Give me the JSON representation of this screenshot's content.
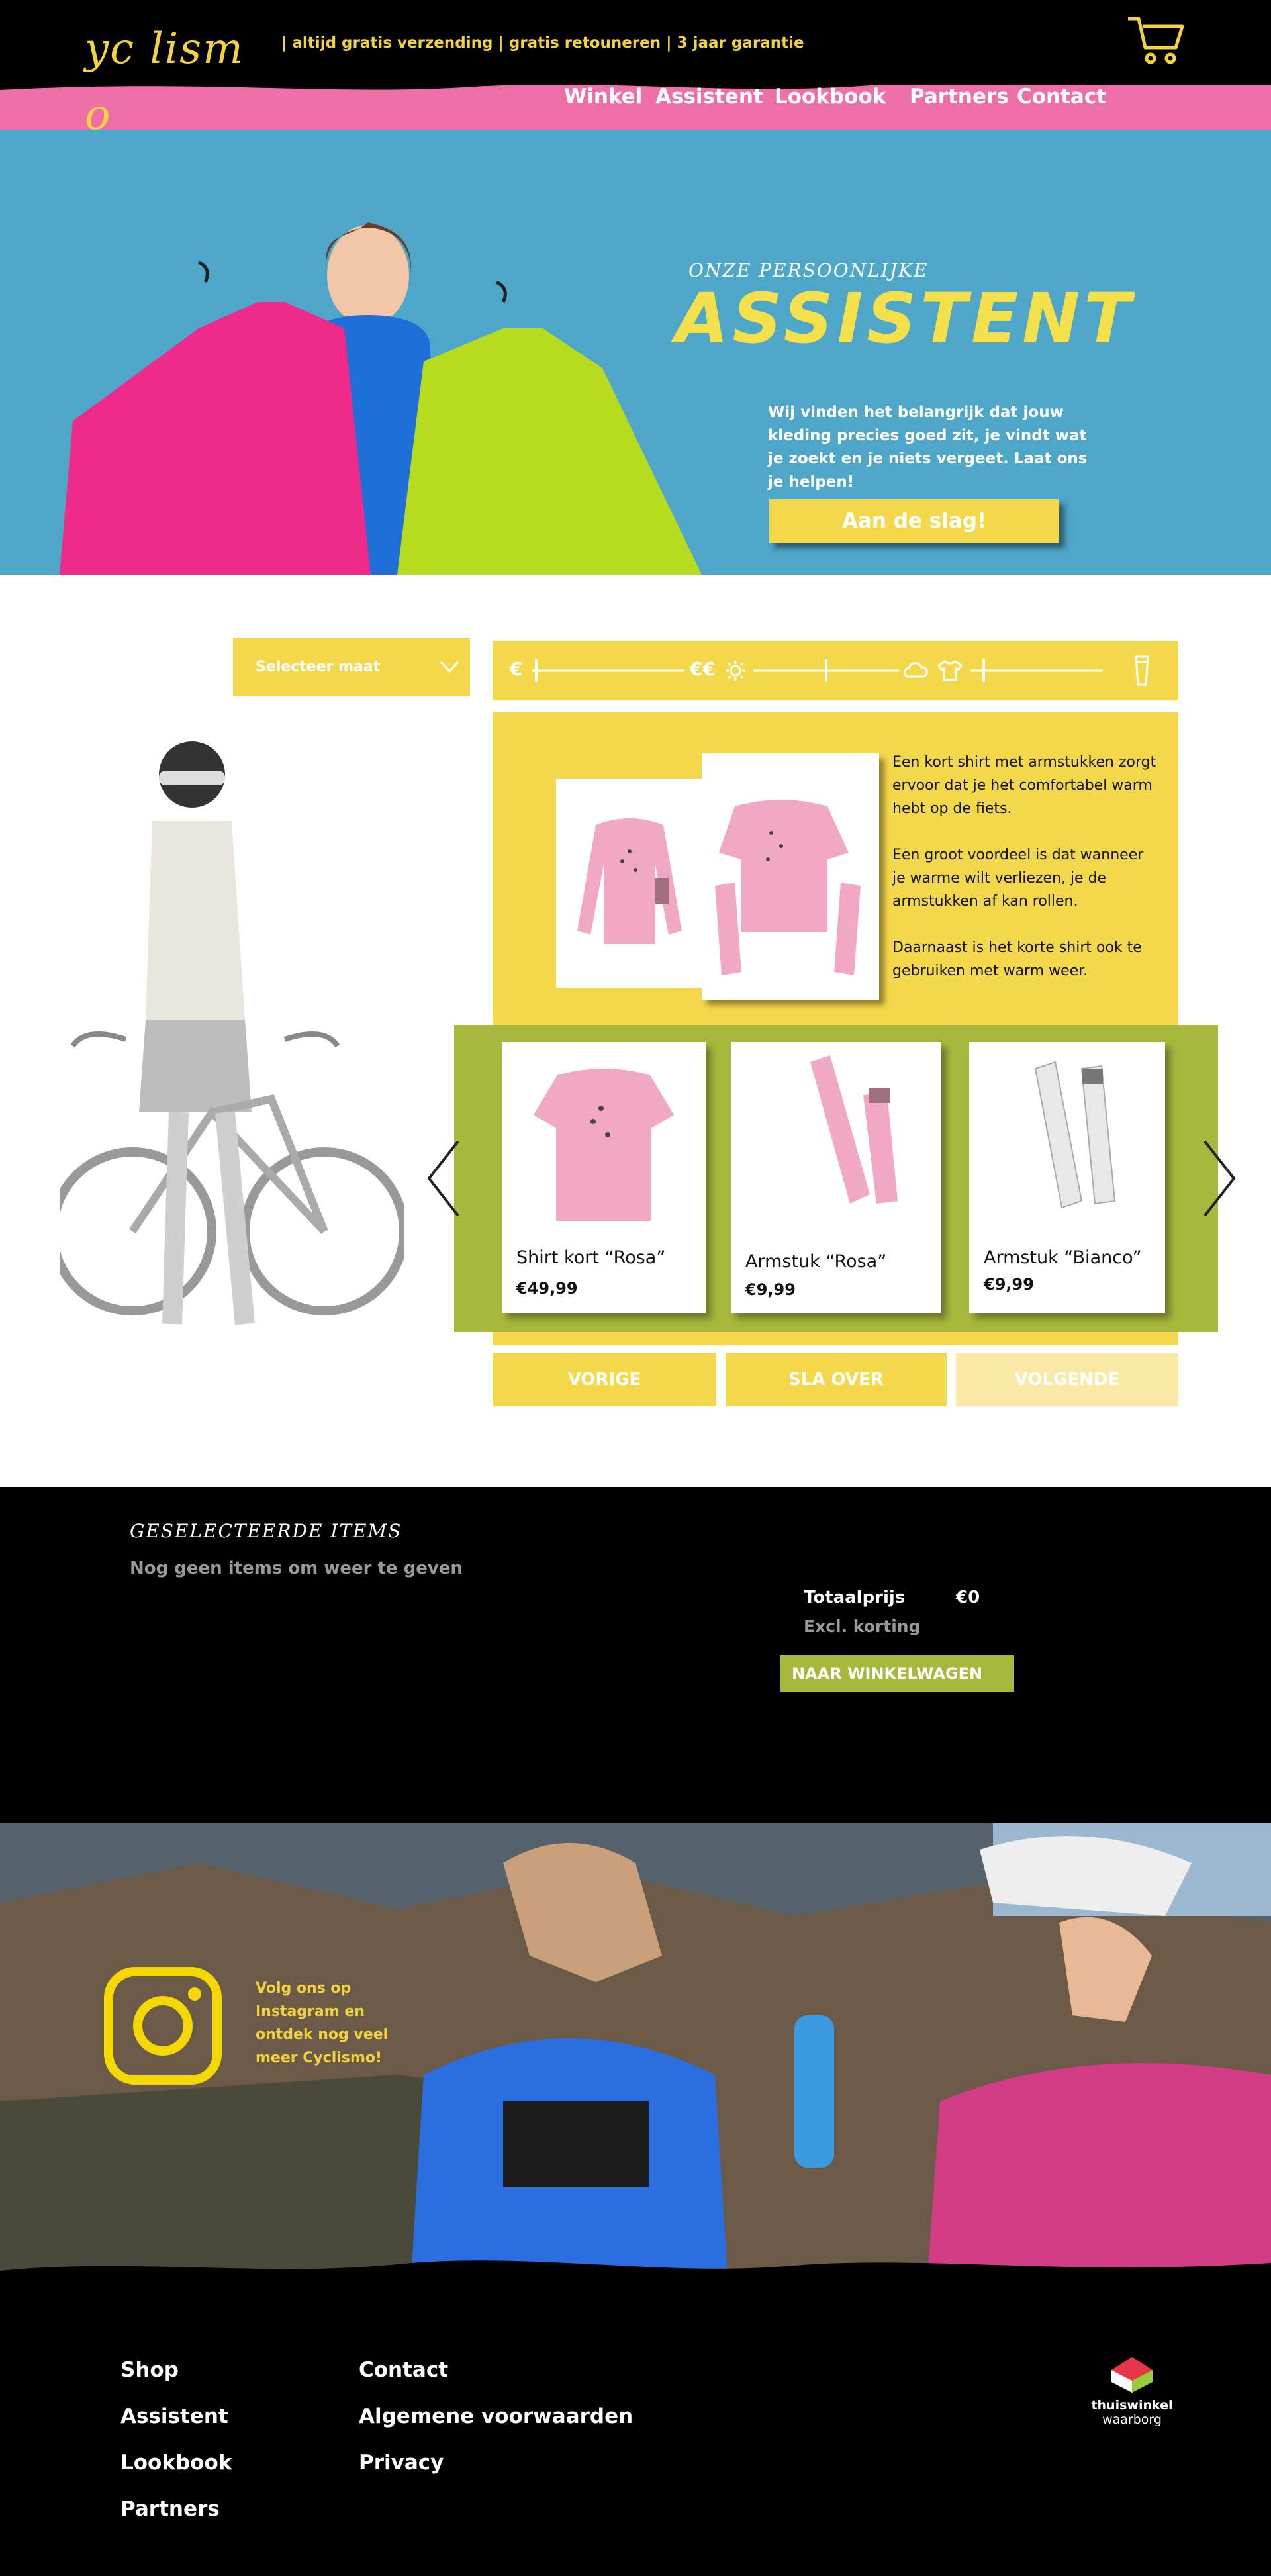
{
  "header": {
    "logo_text": "yc lism o",
    "tagline": "| altijd gratis verzending | gratis retouneren | 3 jaar garantie",
    "nav": [
      "Winkel",
      "Assistent",
      "Lookbook",
      "Partners",
      "Contact"
    ]
  },
  "hero": {
    "subtitle": "ONZE PERSOONLIJKE",
    "title": "ASSISTENT",
    "text": "Wij vinden het belangrijk dat jouw kleding precies goed zit, je vindt wat je zoekt en je niets vergeet. Laat ons je helpen!",
    "cta": "Aan de slag!"
  },
  "assistant": {
    "size_select": "Selecteer maat",
    "filter": {
      "price_low": "€",
      "price_high": "€€"
    },
    "description": [
      "Een kort shirt met armstukken zorgt ervoor dat je het comfortabel warm hebt op de fiets.",
      "Een groot voordeel is dat wanneer je warme wilt verliezen, je de armstukken af kan rollen.",
      "Daarnaast is het korte shirt ook te gebruiken met warm weer."
    ],
    "products": [
      {
        "name": "Shirt kort “Rosa”",
        "price": "€49,99"
      },
      {
        "name": "Armstuk “Rosa”",
        "price": "€9,99"
      },
      {
        "name": "Armstuk “Bianco”",
        "price": "€9,99"
      }
    ],
    "buttons": {
      "prev": "VORIGE",
      "skip": "SLA OVER",
      "next": "VOLGENDE"
    }
  },
  "selected": {
    "title": "GESELECTEERDE ITEMS",
    "empty": "Nog geen items om weer te geven",
    "total_label": "Totaalprijs",
    "total_value": "€0",
    "excl": "Excl. korting",
    "to_cart": "NAAR WINKELWAGEN"
  },
  "instagram": {
    "text": "Volg ons op Instagram en ontdek nog veel meer Cyclismo!"
  },
  "footer": {
    "col1": [
      "Shop",
      "Assistent",
      "Lookbook",
      "Partners"
    ],
    "col2": [
      "Contact",
      "Algemene voorwaarden",
      "Privacy"
    ],
    "badge_line1": "thuiswinkel",
    "badge_line2": "waarborg"
  },
  "colors": {
    "yellow": "#f4d84b",
    "pink": "#ee6fa8",
    "blue": "#4ea6c8",
    "green": "#a7b93c",
    "black": "#000000"
  }
}
